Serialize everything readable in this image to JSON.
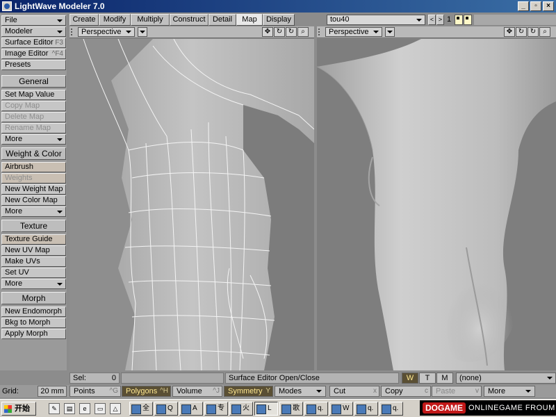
{
  "window": {
    "title": "LightWave Modeler 7.0",
    "minimize": "_",
    "restore": "▫",
    "close": "×"
  },
  "sidebar": {
    "top": [
      {
        "label": "File",
        "arrow": true
      },
      {
        "label": "Modeler",
        "arrow": true
      },
      {
        "label": "Surface Editor",
        "shortcut": "F3"
      },
      {
        "label": "Image Editor",
        "shortcut": "^F4"
      },
      {
        "label": "Presets"
      }
    ],
    "sections": [
      {
        "title": "General",
        "items": [
          {
            "label": "Set Map Value"
          },
          {
            "label": "Copy Map",
            "dim": true
          },
          {
            "label": "Delete Map",
            "dim": true
          },
          {
            "label": "Rename Map",
            "dim": true
          },
          {
            "label": "More",
            "arrow": true
          }
        ]
      },
      {
        "title": "Weight & Color",
        "items": [
          {
            "label": "Airbrush",
            "hl": true
          },
          {
            "label": "Weights",
            "dim": true,
            "hl": true
          },
          {
            "label": "New Weight Map"
          },
          {
            "label": "New Color Map"
          },
          {
            "label": "More",
            "arrow": true
          }
        ]
      },
      {
        "title": "Texture",
        "items": [
          {
            "label": "Texture Guide",
            "hl": true
          },
          {
            "label": "New UV Map"
          },
          {
            "label": "Make UVs"
          },
          {
            "label": "Set UV"
          },
          {
            "label": "More",
            "arrow": true
          }
        ]
      },
      {
        "title": "Morph",
        "items": [
          {
            "label": "New Endomorph"
          },
          {
            "label": "Bkg to Morph"
          },
          {
            "label": "Apply Morph"
          }
        ]
      }
    ]
  },
  "tabs": [
    "Create",
    "Modify",
    "Multiply",
    "Construct",
    "Detail",
    "Map",
    "Display"
  ],
  "active_tab": "Map",
  "object": {
    "name": "tou40",
    "prev": "<",
    "next": ">",
    "layer": "1"
  },
  "viewports": {
    "left": {
      "mode": "Perspective"
    },
    "right": {
      "mode": "Perspective"
    },
    "tools": [
      "✥",
      "↻",
      "⌕"
    ]
  },
  "status": {
    "sel_label": "Sel:",
    "sel_value": "0",
    "message": "Surface Editor Open/Close",
    "wtm": [
      "W",
      "T",
      "M"
    ],
    "vmap": "(none)"
  },
  "grid": {
    "label": "Grid:",
    "value": "20 mm"
  },
  "bottom": [
    {
      "label": "Points",
      "shortcut": "^G"
    },
    {
      "label": "Polygons",
      "shortcut": "^H",
      "on": true
    },
    {
      "label": "Volume",
      "shortcut": "^J"
    },
    {
      "label": "Symmetry",
      "shortcut": "Y",
      "on": true
    },
    {
      "label": "Modes",
      "arrow": true
    },
    {
      "label": "Cut",
      "shortcut": "x"
    },
    {
      "label": "Copy",
      "shortcut": "c"
    },
    {
      "label": "Paste",
      "shortcut": "v",
      "dim": true
    },
    {
      "label": "More",
      "arrow": true
    }
  ],
  "taskbar": {
    "start": "开始",
    "tasks": [
      "全",
      "Q",
      "A",
      "专",
      "火",
      "L",
      "歌",
      "q.",
      "W",
      "q.",
      "q."
    ],
    "logo_a": "DOGAME",
    "logo_b": "ONLINEGAME FROUM"
  }
}
